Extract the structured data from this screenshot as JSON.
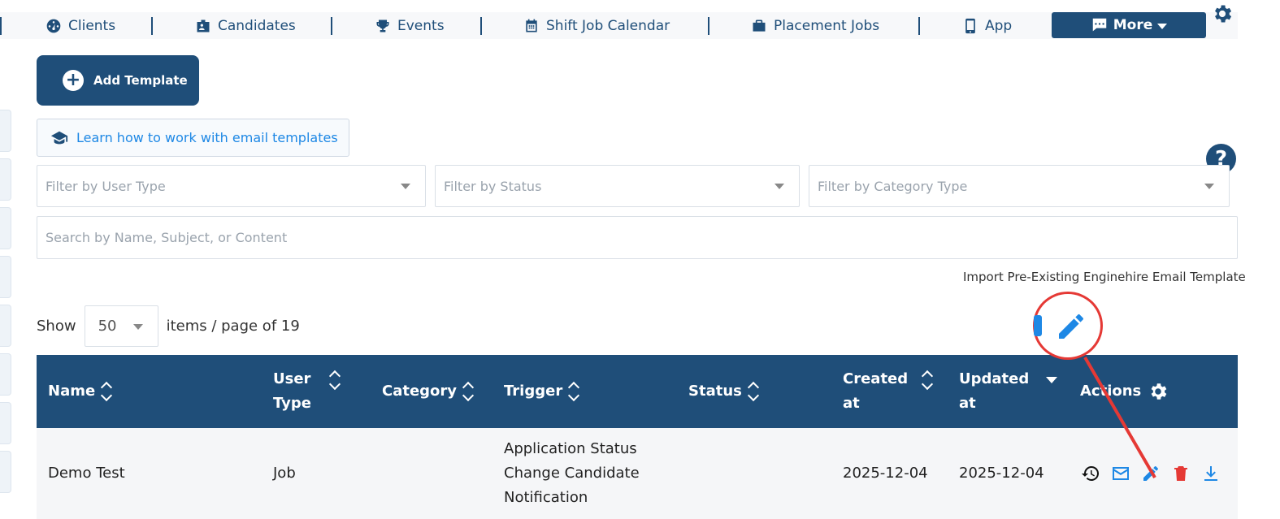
{
  "nav": {
    "items": [
      {
        "label": "Clients",
        "icon": "dashboard-icon"
      },
      {
        "label": "Candidates",
        "icon": "id-badge-icon"
      },
      {
        "label": "Events",
        "icon": "trophy-icon"
      },
      {
        "label": "Shift Job Calendar",
        "icon": "calendar-icon"
      },
      {
        "label": "Placement Jobs",
        "icon": "briefcase-icon"
      },
      {
        "label": "App",
        "icon": "mobile-icon"
      }
    ],
    "more_label": "More"
  },
  "add_template_label": "Add Template",
  "learn_link": "Learn how to work with email templates",
  "filters": {
    "user_type_placeholder": "Filter by User Type",
    "status_placeholder": "Filter by Status",
    "category_placeholder": "Filter by Category Type"
  },
  "search_placeholder": "Search by Name, Subject, or Content",
  "import_link": "Import Pre-Existing Enginehire Email Template",
  "pagination": {
    "show_label": "Show",
    "per_page": "50",
    "suffix": "items / page of 19"
  },
  "table": {
    "headers": {
      "name": "Name",
      "user_type_1": "User",
      "user_type_2": "Type",
      "category": "Category",
      "trigger": "Trigger",
      "status": "Status",
      "created_1": "Created",
      "created_2": "at",
      "updated_1": "Updated",
      "updated_2": "at",
      "actions": "Actions"
    },
    "rows": [
      {
        "name": "Demo Test",
        "user_type": "Job",
        "category": "",
        "trigger_1": "Application Status",
        "trigger_2": "Change Candidate",
        "trigger_3": "Notification",
        "status": "",
        "created": "2025-12-04",
        "updated": "2025-12-04"
      }
    ]
  },
  "colors": {
    "primary": "#1f4e79",
    "link": "#1e88e5",
    "delete": "#e53935",
    "annotation": "#e53935"
  }
}
